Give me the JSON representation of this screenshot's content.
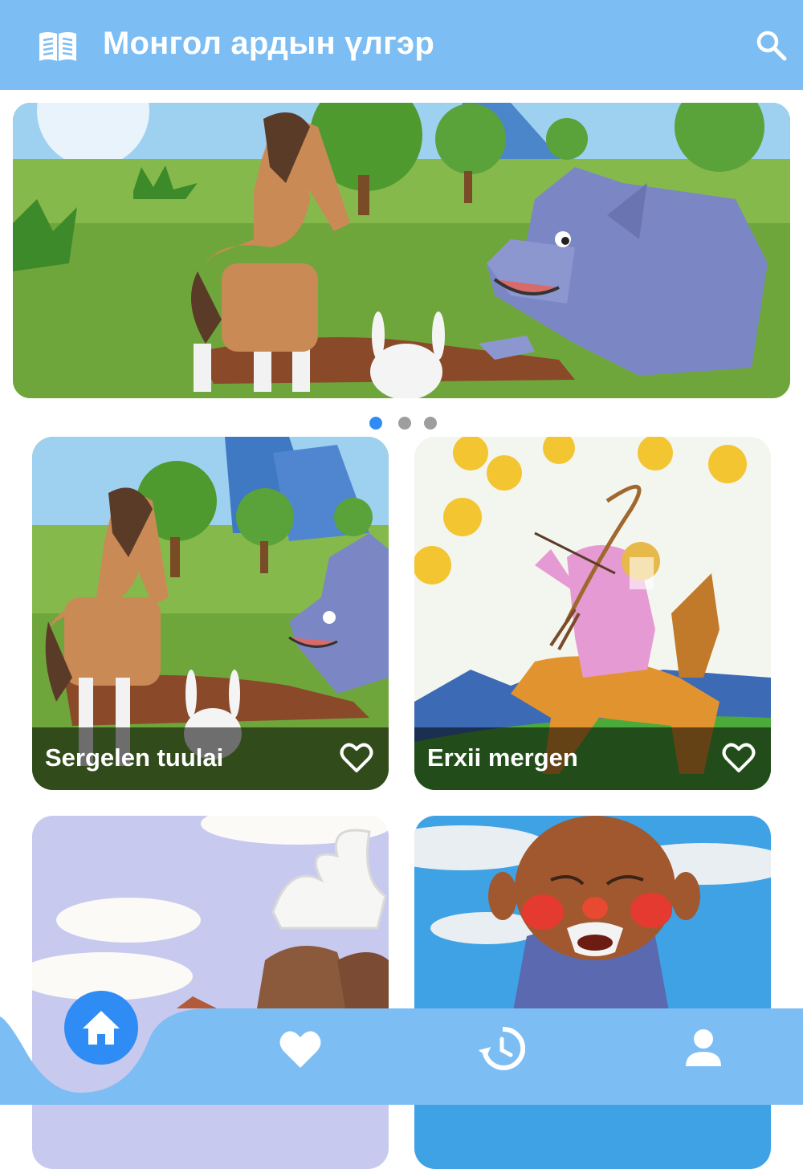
{
  "app": {
    "title": "Монгол ардын үлгэр",
    "accent_color": "#7cbdf3",
    "active_color": "#2f8cf5"
  },
  "appbar": {
    "menu_icon": "book-open-icon",
    "search_icon": "search-icon"
  },
  "carousel": {
    "image": "illustration: horse foal and grey wolf in meadow",
    "page_count": 3,
    "active_index": 0
  },
  "stories": [
    {
      "title": "Sergelen tuulai",
      "image": "illustration: foal, wolf and white rabbit",
      "favorite": false
    },
    {
      "title": "Erxii mergen",
      "image": "illustration: archer on horse shooting at suns",
      "favorite": false
    },
    {
      "title": "",
      "image": "illustration: deer with large antlers and camels",
      "favorite": false
    },
    {
      "title": "",
      "image": "illustration: old bald man with grey moustache",
      "favorite": false
    }
  ],
  "bottom_nav": [
    {
      "icon": "home-icon",
      "active": true
    },
    {
      "icon": "heart-icon",
      "active": false
    },
    {
      "icon": "history-icon",
      "active": false
    },
    {
      "icon": "person-icon",
      "active": false
    }
  ]
}
